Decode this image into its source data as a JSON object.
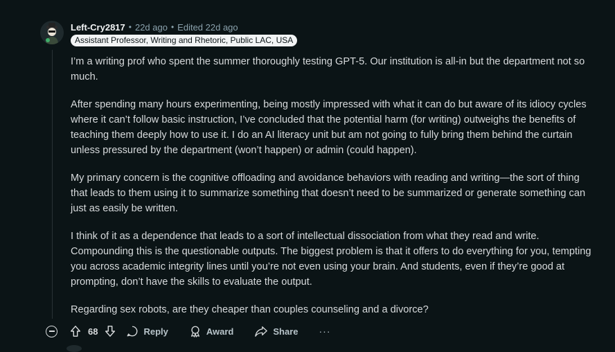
{
  "comment": {
    "username": "Left-Cry2817",
    "time": "22d ago",
    "edited": "Edited 22d ago",
    "flair": "Assistant Professor, Writing and Rhetoric, Public LAC, USA",
    "paragraphs": [
      "I’m a writing prof who spent the summer thoroughly testing GPT-5. Our institution is all-in but the department not so much.",
      "After spending many hours experimenting, being mostly impressed with what it can do but aware of its idiocy cycles where it can’t follow basic instruction, I’ve concluded that the potential harm (for writing) outweighs the benefits of teaching them deeply how to use it. I do an AI literacy unit but am not going to fully bring them behind the curtain unless pressured by the department (won’t happen) or admin (could happen).",
      "My primary concern is the cognitive offloading and avoidance behaviors with reading and writing—the sort of thing that leads to them using it to summarize something that doesn’t need to be summarized or generate something can just as easily be written.",
      "I think of it as a dependence that leads to a sort of intellectual dissociation from what they read and write. Compounding this is the questionable outputs. The biggest problem is that it offers to do everything for you, tempting you across academic integrity lines until you’re not even using your brain. And students, even if they’re good at prompting, don’t have the skills to evaluate the output.",
      "Regarding sex robots, are they cheaper than couples counseling and a divorce?"
    ]
  },
  "actions": {
    "score": "68",
    "reply": "Reply",
    "award": "Award",
    "share": "Share",
    "more": "···"
  },
  "colors": {
    "background": "#0b1416",
    "text": "#d7dadc",
    "meta": "#8ba2ad",
    "flair_bg": "#f2f4f5"
  },
  "icons": [
    "avatar",
    "collapse-icon",
    "upvote-icon",
    "downvote-icon",
    "reply-icon",
    "award-icon",
    "share-icon",
    "more-icon"
  ]
}
